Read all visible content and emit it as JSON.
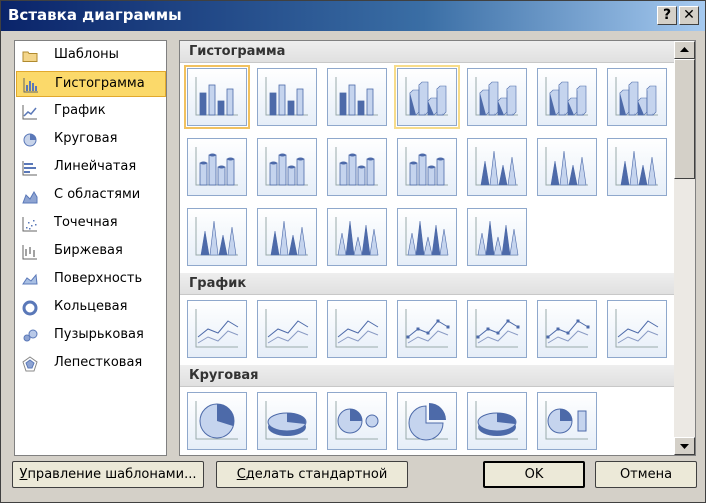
{
  "window": {
    "title": "Вставка диаграммы",
    "help_label": "?",
    "close_label": "✕"
  },
  "categories": [
    {
      "label": "Шаблоны",
      "icon": "folder-icon"
    },
    {
      "label": "Гистограмма",
      "icon": "column-chart-icon",
      "selected": true
    },
    {
      "label": "График",
      "icon": "line-chart-icon"
    },
    {
      "label": "Круговая",
      "icon": "pie-chart-icon"
    },
    {
      "label": "Линейчатая",
      "icon": "bar-chart-icon"
    },
    {
      "label": "С областями",
      "icon": "area-chart-icon"
    },
    {
      "label": "Точечная",
      "icon": "scatter-chart-icon"
    },
    {
      "label": "Биржевая",
      "icon": "stock-chart-icon"
    },
    {
      "label": "Поверхность",
      "icon": "surface-chart-icon"
    },
    {
      "label": "Кольцевая",
      "icon": "doughnut-chart-icon"
    },
    {
      "label": "Пузырьковая",
      "icon": "bubble-chart-icon"
    },
    {
      "label": "Лепестковая",
      "icon": "radar-chart-icon"
    }
  ],
  "sections": [
    {
      "title": "Гистограмма",
      "subtype_rows": [
        7,
        7,
        5
      ]
    },
    {
      "title": "График",
      "subtype_rows": [
        7
      ]
    },
    {
      "title": "Круговая",
      "subtype_rows": [
        6
      ]
    }
  ],
  "buttons": {
    "manage_prefix": "У",
    "manage_rest": "правление шаблонами...",
    "default_prefix": "С",
    "default_rest": "делать стандартной",
    "ok": "OK",
    "cancel": "Отмена"
  }
}
